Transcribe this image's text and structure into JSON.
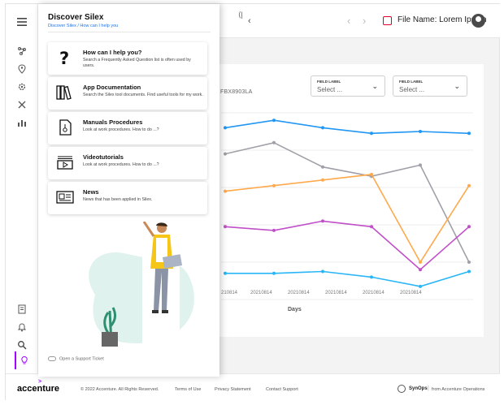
{
  "topbar": {
    "file_label": "File Name: Lorem Ipsum"
  },
  "panel": {
    "title": "Discover Silex",
    "breadcrumb": "Discover Silex / How can I help you",
    "cards": [
      {
        "title": "How can I help you?",
        "desc": "Search a Frequently Asked Question list is often used by users.",
        "icon": "question-icon"
      },
      {
        "title": "App Documentation",
        "desc": "Search the Silex tool documents. Find useful tools for my work.",
        "icon": "books-icon"
      },
      {
        "title": "Manuals Procedures",
        "desc": "Look at work procedures. How to do ...?",
        "icon": "manual-icon"
      },
      {
        "title": "Videotutorials",
        "desc": "Look at work procedures. How to do ...?",
        "icon": "video-icon"
      },
      {
        "title": "News",
        "desc": "News that has been applied in Silex.",
        "icon": "newspaper-icon"
      }
    ],
    "support_link": "Open a Support Ticket"
  },
  "filters": [
    {
      "label": "FIELD LABEL",
      "placeholder": "Select ..."
    },
    {
      "label": "FIELD LABEL",
      "placeholder": "Select ..."
    }
  ],
  "card_code": "FBX8903LA",
  "chart_data": {
    "type": "line",
    "x": [
      "20210814",
      "20210814",
      "20210814",
      "20210814",
      "20210814",
      "20210814",
      "20210814"
    ],
    "x_tick_labels_visible": [
      "210814",
      "20210814",
      "20210814",
      "20210814",
      "20210814",
      "20210814"
    ],
    "xlabel": "Days",
    "ylim": [
      0,
      100
    ],
    "grid": true,
    "series": [
      {
        "color": "#2196f3",
        "values": [
          92,
          96,
          92,
          89,
          90,
          89
        ]
      },
      {
        "color": "#a0a0a8",
        "values": [
          78,
          84,
          71,
          66,
          72,
          20
        ]
      },
      {
        "color": "#ffa94d",
        "values": [
          58,
          61,
          64,
          67,
          20,
          61
        ]
      },
      {
        "color": "#c04fc8",
        "values": [
          39,
          37,
          42,
          39,
          16,
          39
        ]
      },
      {
        "color": "#29b6f6",
        "values": [
          14,
          14,
          15,
          12,
          7,
          15
        ]
      }
    ]
  },
  "footer": {
    "brand": "accenture",
    "copyright": "© 2022 Accenture. All Rights Reserved.",
    "terms": "Terms of Use",
    "privacy": "Privacy Statement",
    "contact": "Contact Support",
    "synops": "SynOps",
    "from": "from Accenture Operations"
  }
}
